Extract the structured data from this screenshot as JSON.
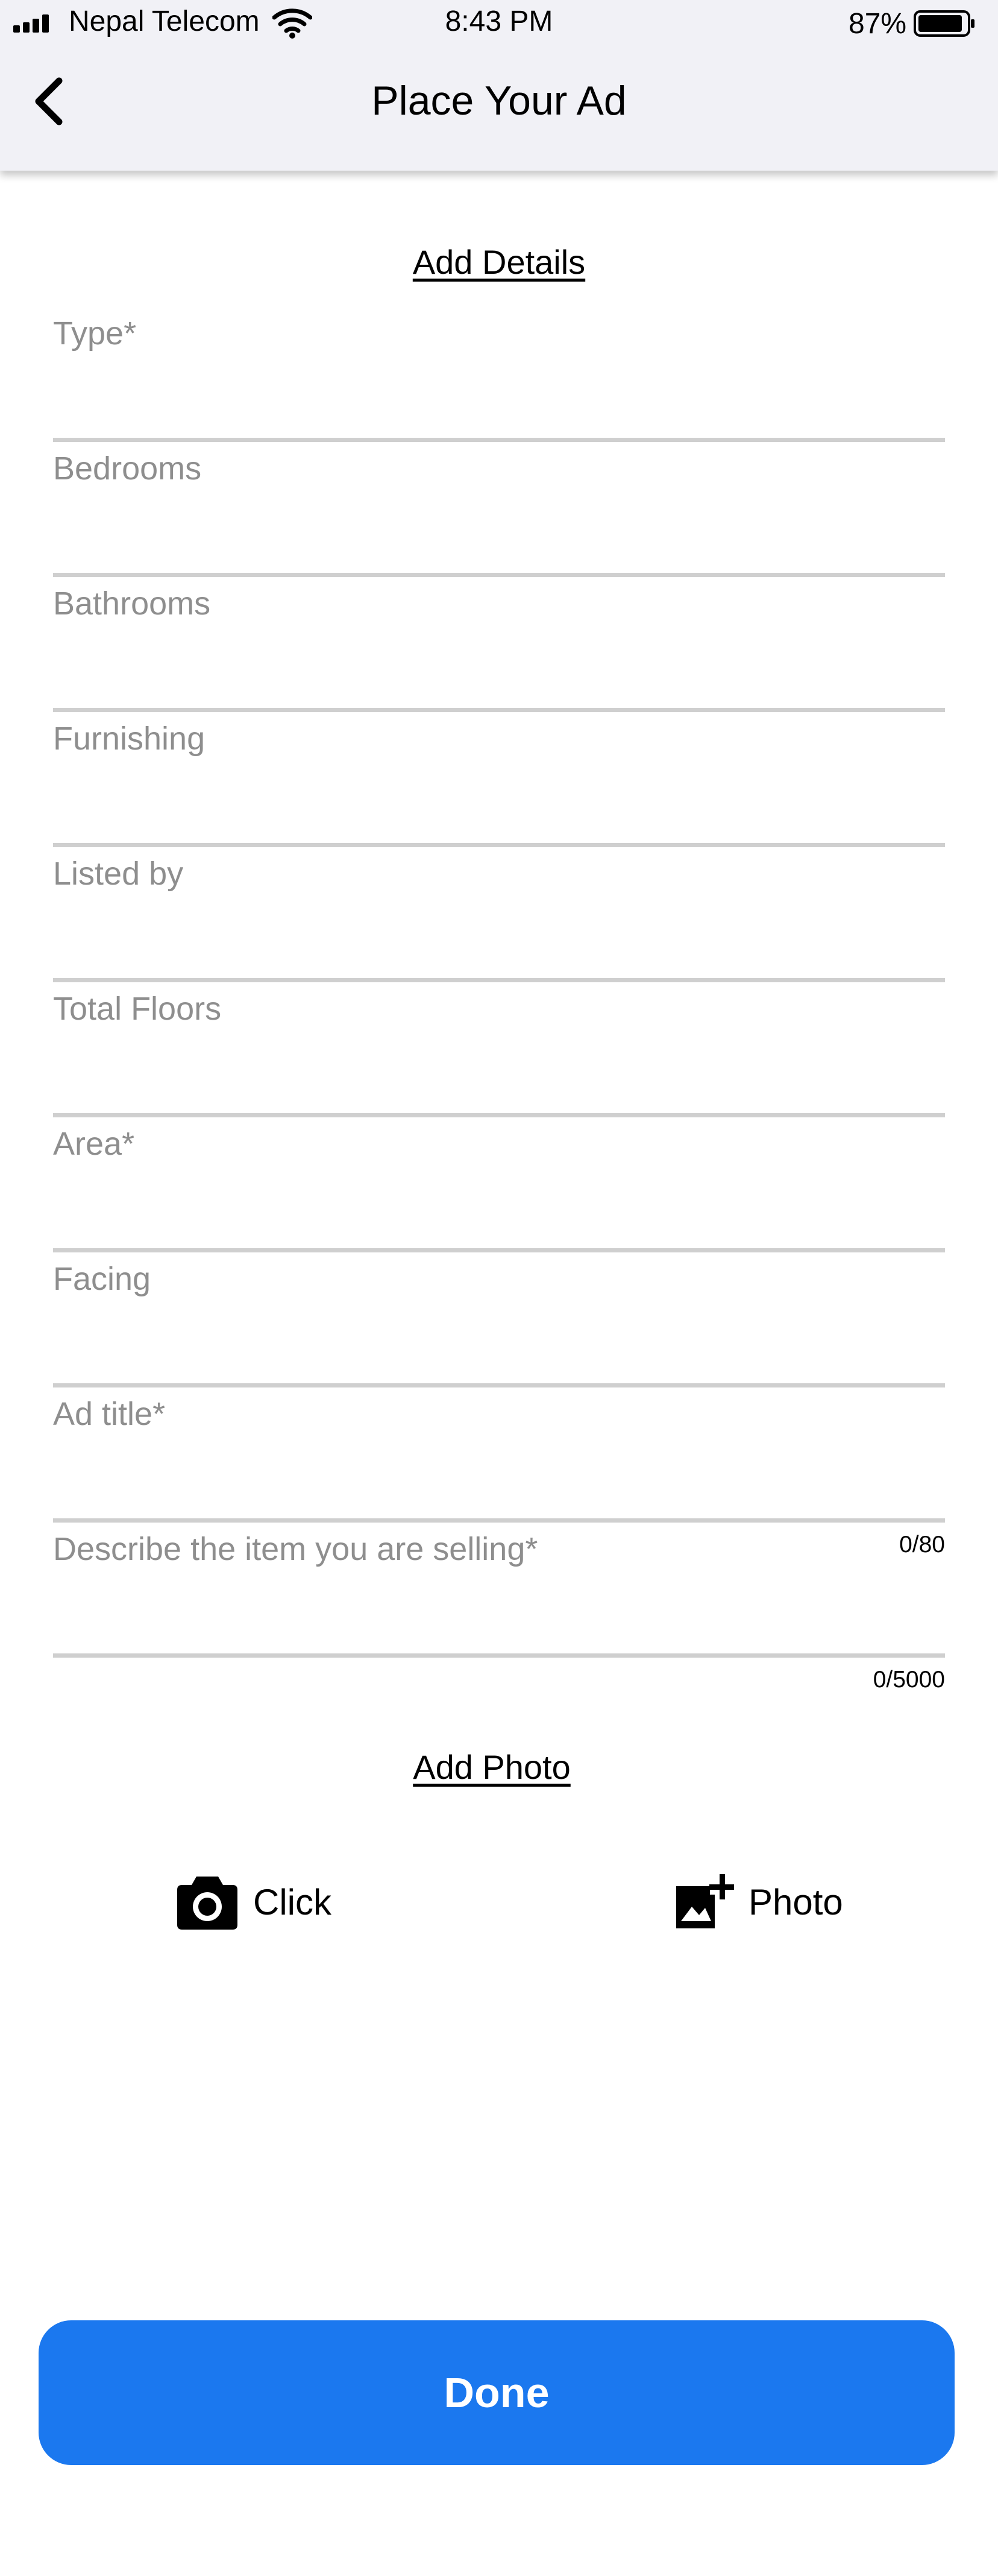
{
  "status_bar": {
    "carrier": "Nepal Telecom",
    "time": "8:43 PM",
    "battery_percent": "87%",
    "icons": [
      "signal-icon",
      "wifi-icon",
      "battery-icon"
    ]
  },
  "header": {
    "back_icon": "chevron-left-icon",
    "title": "Place Your Ad"
  },
  "details": {
    "heading": "Add Details",
    "fields": [
      {
        "label": "Type*",
        "value": ""
      },
      {
        "label": "Bedrooms",
        "value": ""
      },
      {
        "label": "Bathrooms",
        "value": ""
      },
      {
        "label": "Furnishing",
        "value": ""
      },
      {
        "label": "Listed by",
        "value": ""
      },
      {
        "label": "Total Floors",
        "value": ""
      },
      {
        "label": "Area*",
        "value": ""
      },
      {
        "label": "Facing",
        "value": ""
      },
      {
        "label": "Ad title*",
        "value": "",
        "counter": "0/80"
      },
      {
        "label": "Describe the item you are selling*",
        "value": "",
        "counter": "0/5000"
      }
    ]
  },
  "photo": {
    "heading": "Add Photo",
    "click_label": "Click",
    "click_icon": "camera-icon",
    "photo_label": "Photo",
    "photo_icon": "add-photo-icon"
  },
  "done_label": "Done",
  "colors": {
    "header_bg": "#f1f1f6",
    "accent": "#1b78ef",
    "placeholder": "#8e8e8e",
    "divider": "#cfcfcf"
  }
}
